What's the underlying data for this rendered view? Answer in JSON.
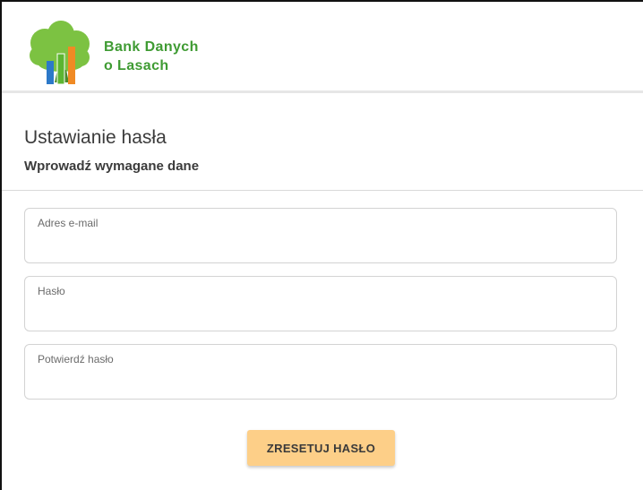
{
  "header": {
    "brand_line1": "Bank Danych",
    "brand_line2": "o Lasach",
    "colors": {
      "brand_green": "#3f9b33",
      "tree_green": "#7cc242",
      "bar_blue": "#2c79c9",
      "bar_green": "#5cb531",
      "bar_orange": "#f08a24",
      "trunk": "#4b8b2a"
    }
  },
  "form": {
    "title": "Ustawianie hasła",
    "subtitle": "Wprowadź wymagane dane",
    "fields": {
      "email": {
        "label": "Adres e-mail",
        "value": ""
      },
      "password": {
        "label": "Hasło",
        "value": ""
      },
      "confirm": {
        "label": "Potwierdź hasło",
        "value": ""
      }
    },
    "submit_label": "ZRESETUJ HASŁO",
    "submit_color": "#fdcf88"
  }
}
